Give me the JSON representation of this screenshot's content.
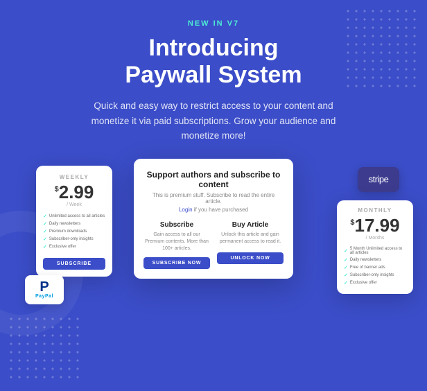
{
  "badge": "NEW IN V7",
  "main_title": "Introducing\nPaywall System",
  "subtitle": "Quick and easy way to restrict access to your content and monetize it via paid subscriptions. Grow your audience and monetize more!",
  "weekly_card": {
    "label": "WEEKLY",
    "currency": "$",
    "price": "2.99",
    "period": "/ Week",
    "features": [
      "Unlimited access to all articles",
      "Daily newsletters",
      "Premium downloads",
      "Subscriber-only insights",
      "Exclusive offer"
    ],
    "button_label": "SUBSCRIBE"
  },
  "modal": {
    "title": "Support authors and subscribe to content",
    "description": "This is premium stuff. Subscribe to read the entire article.",
    "login_text": "Login",
    "login_suffix": " if you have purchased",
    "subscribe_option": {
      "title": "Subscribe",
      "description": "Gain access to all our Premium contents. More than 100+ articles.",
      "button_label": "SUBSCRIBE NOW"
    },
    "buy_article_option": {
      "title": "Buy Article",
      "description": "Unlock this article and gain permanent access to read it.",
      "button_label": "UNLOCK NOW"
    }
  },
  "stripe_label": "stripe",
  "monthly_card": {
    "label": "MONTHLY",
    "currency": "$",
    "price": "17.99",
    "period": "/ Months",
    "features": [
      "5 Month Unlimited access to all articles",
      "Daily newsletters",
      "Free of banner ads",
      "Subscriber-only insights",
      "Exclusive offer"
    ]
  },
  "paypal_label": "PayPal"
}
